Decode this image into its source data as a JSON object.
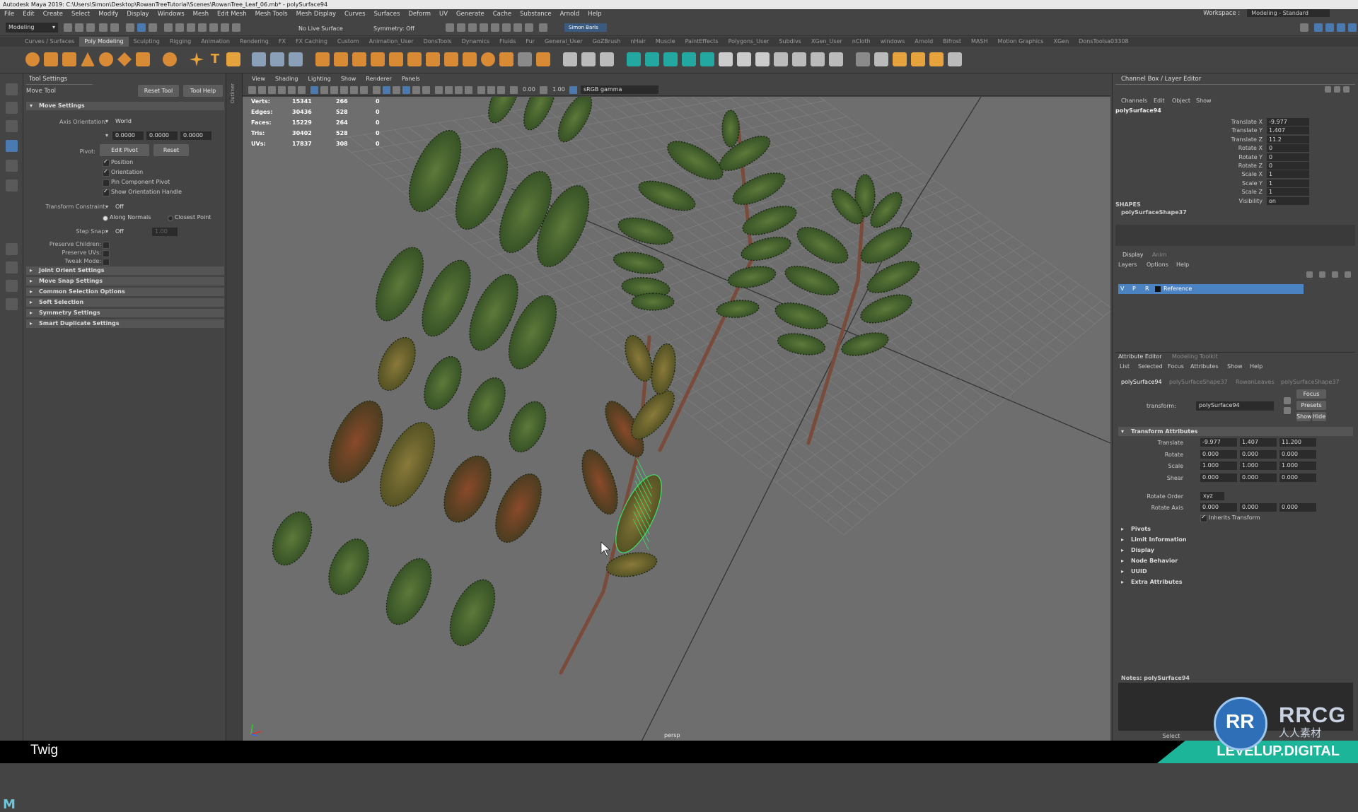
{
  "title": "Autodesk Maya 2019: C:\\Users\\Simon\\Desktop\\RowanTreeTutorial\\Scenes\\RowanTree_Leaf_06.mb* - polySurface94",
  "menus": [
    "File",
    "Edit",
    "Create",
    "Select",
    "Modify",
    "Display",
    "Windows",
    "Mesh",
    "Edit Mesh",
    "Mesh Tools",
    "Mesh Display",
    "Curves",
    "Surfaces",
    "Deform",
    "UV",
    "Generate",
    "Cache",
    "Substance",
    "Arnold",
    "Help"
  ],
  "workspace": {
    "label": "Workspace :",
    "value": "Modeling - Standard"
  },
  "status": {
    "mode": "Modeling",
    "live": "No Live Surface",
    "symmetry": "Symmetry: Off",
    "user": "Simon Barls"
  },
  "shelf_tabs": [
    "Curves / Surfaces",
    "Poly Modeling",
    "Sculpting",
    "Rigging",
    "Animation",
    "Rendering",
    "FX",
    "FX Caching",
    "Custom",
    "Animation_User",
    "DonsTools",
    "Dynamics",
    "Fluids",
    "Fur",
    "General_User",
    "GoZBrush",
    "nHair",
    "Muscle",
    "PaintEffects",
    "Polygons_User",
    "Subdivs",
    "XGen_User",
    "nCloth",
    "windows",
    "Arnold",
    "Bifrost",
    "MASH",
    "Motion Graphics",
    "XGen",
    "DonsToolsa03308"
  ],
  "tool_settings": {
    "title": "Tool Settings",
    "tool": "Move Tool",
    "reset": "Reset Tool",
    "help": "Tool Help",
    "move_settings": "Move Settings",
    "axis_orientation_label": "Axis Orientation:",
    "axis_orientation": "World",
    "axis_values": [
      "0.0000",
      "0.0000",
      "0.0000"
    ],
    "pivot_label": "Pivot:",
    "edit_pivot": "Edit Pivot",
    "reset_btn": "Reset",
    "checks": [
      {
        "label": "Position",
        "on": true
      },
      {
        "label": "Orientation",
        "on": true
      },
      {
        "label": "Pin Component Pivot",
        "on": false
      },
      {
        "label": "Show Orientation Handle",
        "on": true
      }
    ],
    "transform_constraint_label": "Transform Constraint:",
    "transform_constraint": "Off",
    "along_normals": "Along Normals",
    "closest_point": "Closest Point",
    "step_snap_label": "Step Snap:",
    "step_snap": "Off",
    "step_value": "1.00",
    "preserve_children": "Preserve Children:",
    "preserve_uvs": "Preserve UVs:",
    "tweak_mode": "Tweak Mode:",
    "sections": [
      "Joint Orient Settings",
      "Move Snap Settings",
      "Common Selection Options",
      "Soft Selection",
      "Symmetry Settings",
      "Smart Duplicate Settings"
    ]
  },
  "outliner_label": "Outliner",
  "viewport": {
    "menus": [
      "View",
      "Shading",
      "Lighting",
      "Show",
      "Renderer",
      "Panels"
    ],
    "val1": "0.00",
    "val2": "1.00",
    "colorspace": "sRGB gamma",
    "camera": "persp",
    "hud": [
      {
        "label": "Verts:",
        "a": "15341",
        "b": "266",
        "c": "0"
      },
      {
        "label": "Edges:",
        "a": "30436",
        "b": "528",
        "c": "0"
      },
      {
        "label": "Faces:",
        "a": "15229",
        "b": "264",
        "c": "0"
      },
      {
        "label": "Tris:",
        "a": "30402",
        "b": "528",
        "c": "0"
      },
      {
        "label": "UVs:",
        "a": "17837",
        "b": "308",
        "c": "0"
      }
    ]
  },
  "channel_box": {
    "title": "Channel Box / Layer Editor",
    "menus": [
      "Channels",
      "Edit",
      "Object",
      "Show"
    ],
    "object": "polySurface94",
    "channels": [
      {
        "label": "Translate X",
        "value": "-9.977"
      },
      {
        "label": "Translate Y",
        "value": "1.407"
      },
      {
        "label": "Translate Z",
        "value": "11.2"
      },
      {
        "label": "Rotate X",
        "value": "0"
      },
      {
        "label": "Rotate Y",
        "value": "0"
      },
      {
        "label": "Rotate Z",
        "value": "0"
      },
      {
        "label": "Scale X",
        "value": "1"
      },
      {
        "label": "Scale Y",
        "value": "1"
      },
      {
        "label": "Scale Z",
        "value": "1"
      },
      {
        "label": "Visibility",
        "value": "on"
      }
    ],
    "shapes_label": "SHAPES",
    "shape": "polySurfaceShape37"
  },
  "layer_editor": {
    "tabs": [
      "Display",
      "Anim"
    ],
    "menus": [
      "Layers",
      "Options",
      "Help"
    ],
    "layer": {
      "v": "V",
      "p": "P",
      "r": "R",
      "name": "Reference"
    }
  },
  "attribute_editor": {
    "tabs": [
      "Attribute Editor",
      "Modeling Toolkit"
    ],
    "menus": [
      "List",
      "Selected",
      "Focus",
      "Attributes",
      "Show",
      "Help"
    ],
    "nodes": [
      "polySurface94",
      "polySurfaceShape37",
      "RowanLeaves",
      "polySurfaceShape37"
    ],
    "transform_label": "transform:",
    "transform": "polySurface94",
    "focus": "Focus",
    "presets": "Presets",
    "show": "Show",
    "hide": "Hide",
    "section": "Transform Attributes",
    "rows": [
      {
        "label": "Translate",
        "v": [
          "-9.977",
          "1.407",
          "11.200"
        ]
      },
      {
        "label": "Rotate",
        "v": [
          "0.000",
          "0.000",
          "0.000"
        ]
      },
      {
        "label": "Scale",
        "v": [
          "1.000",
          "1.000",
          "1.000"
        ]
      },
      {
        "label": "Shear",
        "v": [
          "0.000",
          "0.000",
          "0.000"
        ]
      }
    ],
    "rotate_order_label": "Rotate Order",
    "rotate_order": "xyz",
    "rotate_axis_label": "Rotate Axis",
    "rotate_axis": [
      "0.000",
      "0.000",
      "0.000"
    ],
    "inherits": "Inherits Transform",
    "collapsed": [
      "Pivots",
      "Limit Information",
      "Display",
      "Node Behavior",
      "UUID",
      "Extra Attributes"
    ],
    "notes": "Notes: polySurface94",
    "select": "Select"
  },
  "caption": "Twig",
  "watermark": {
    "brand": "RRCG",
    "cn": "人人素材",
    "logo": "RR",
    "site": "LEVELUP.DIGITAL"
  }
}
